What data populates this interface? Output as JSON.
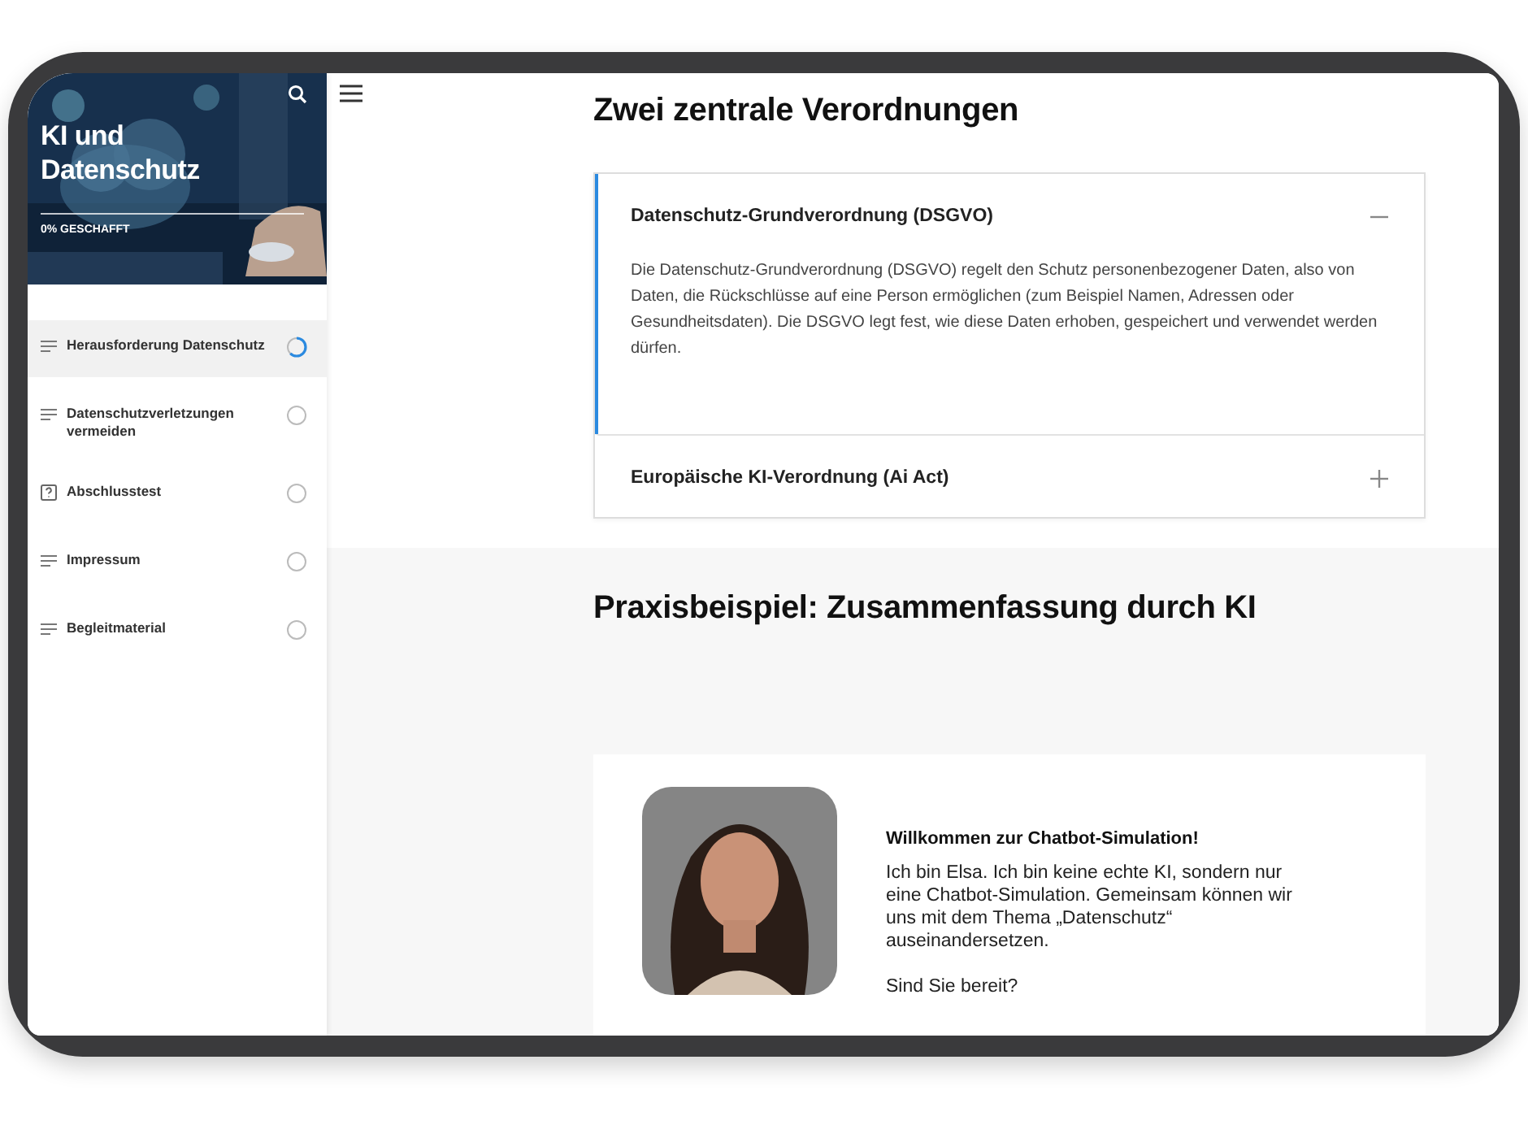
{
  "sidebar": {
    "title": "KI und Datenschutz",
    "progress_label": "0% GESCHAFFT",
    "items": [
      {
        "label": "Herausforderung Datenschutz",
        "kind": "page",
        "selected": true,
        "in_progress": true
      },
      {
        "label": "Datenschutzverletzungen vermeiden",
        "kind": "page",
        "selected": false,
        "in_progress": false
      },
      {
        "label": "Abschlusstest",
        "kind": "quiz",
        "selected": false,
        "in_progress": false
      },
      {
        "label": "Impressum",
        "kind": "page",
        "selected": false,
        "in_progress": false
      },
      {
        "label": "Begleitmaterial",
        "kind": "page",
        "selected": false,
        "in_progress": false
      }
    ]
  },
  "sections": [
    {
      "heading": "Zwei zentrale Verordnungen",
      "accordion": [
        {
          "title": "Datenschutz-Grundverordnung (DSGVO)",
          "expanded": true,
          "body": "Die Datenschutz-Grundverordnung (DSGVO) regelt den Schutz personenbezogener Daten, also von Daten, die Rückschlüsse auf eine Person ermöglichen (zum Beispiel Namen, Adressen oder Gesundheitsdaten). Die DSGVO legt  fest, wie diese Daten erhoben, gespeichert und verwendet werden dürfen."
        },
        {
          "title": "Europäische KI-Verordnung (Ai Act)",
          "expanded": false
        }
      ]
    },
    {
      "heading": "Praxisbeispiel: Zusammenfassung durch KI",
      "chat": {
        "title": "Willkommen zur Chatbot-Simulation!",
        "paragraphs": [
          "Ich bin Elsa. Ich bin keine echte KI, sondern nur eine Chatbot-Simulation. Gemeinsam können wir uns mit dem Thema „Datenschutz“ auseinandersetzen.",
          "Sind Sie bereit?"
        ]
      }
    }
  ]
}
